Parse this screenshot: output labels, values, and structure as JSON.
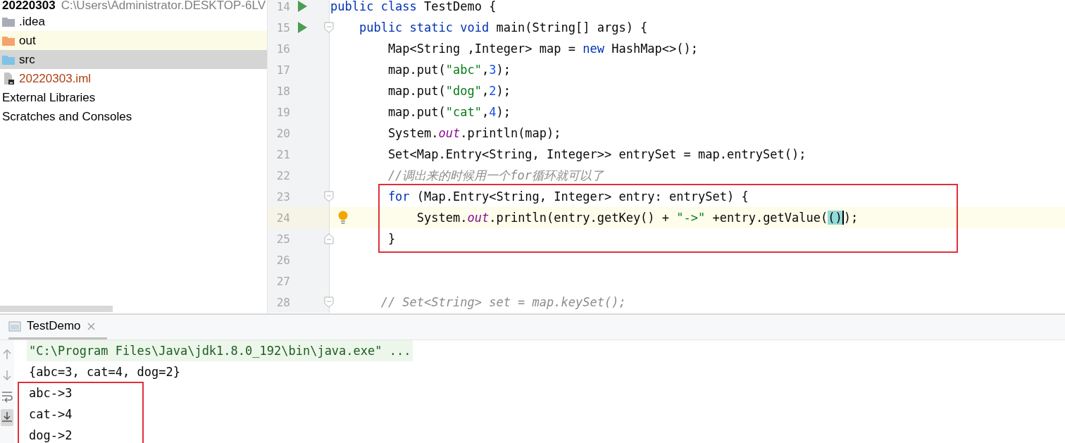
{
  "project": {
    "name": "20220303",
    "path": "C:\\Users\\Administrator.DESKTOP-6LV",
    "items": [
      {
        "label": ".idea",
        "kind": "folder",
        "color": "#a8adb5",
        "selected": false
      },
      {
        "label": "out",
        "kind": "folder",
        "color": "#f4a36c",
        "selected": false,
        "highlighted": true
      },
      {
        "label": "src",
        "kind": "folder",
        "color": "#7ec3e6",
        "selected": true
      },
      {
        "label": "20220303.iml",
        "kind": "module-file",
        "selected": false
      },
      {
        "label": "External Libraries",
        "kind": "plain",
        "selected": false
      },
      {
        "label": "Scratches and Consoles",
        "kind": "plain",
        "selected": false
      }
    ]
  },
  "editor": {
    "lines": [
      {
        "number": "14",
        "run": true,
        "tokens": [
          {
            "kind": "kw",
            "text": "public class "
          },
          {
            "kind": "plain",
            "text": "TestDemo {"
          }
        ]
      },
      {
        "number": "15",
        "run": true,
        "fold_start": true,
        "tokens": [
          {
            "kind": "kw",
            "text": "    public static void "
          },
          {
            "kind": "plain",
            "text": "main(String[] args) {"
          }
        ]
      },
      {
        "number": "16",
        "tokens": [
          {
            "kind": "plain",
            "text": "        Map<String ,Integer> map = "
          },
          {
            "kind": "kw",
            "text": "new "
          },
          {
            "kind": "plain",
            "text": "HashMap<>();"
          }
        ]
      },
      {
        "number": "17",
        "tokens": [
          {
            "kind": "plain",
            "text": "        map.put("
          },
          {
            "kind": "str",
            "text": "\"abc\""
          },
          {
            "kind": "plain",
            "text": ","
          },
          {
            "kind": "num",
            "text": "3"
          },
          {
            "kind": "plain",
            "text": ");"
          }
        ]
      },
      {
        "number": "18",
        "tokens": [
          {
            "kind": "plain",
            "text": "        map.put("
          },
          {
            "kind": "str",
            "text": "\"dog\""
          },
          {
            "kind": "plain",
            "text": ","
          },
          {
            "kind": "num",
            "text": "2"
          },
          {
            "kind": "plain",
            "text": ");"
          }
        ]
      },
      {
        "number": "19",
        "tokens": [
          {
            "kind": "plain",
            "text": "        map.put("
          },
          {
            "kind": "str",
            "text": "\"cat\""
          },
          {
            "kind": "plain",
            "text": ","
          },
          {
            "kind": "num",
            "text": "4"
          },
          {
            "kind": "plain",
            "text": ");"
          }
        ]
      },
      {
        "number": "20",
        "tokens": [
          {
            "kind": "plain",
            "text": "        System."
          },
          {
            "kind": "field",
            "text": "out"
          },
          {
            "kind": "plain",
            "text": ".println(map);"
          }
        ]
      },
      {
        "number": "21",
        "tokens": [
          {
            "kind": "plain",
            "text": "        Set<Map.Entry<String, Integer>> entrySet = map.entrySet();"
          }
        ]
      },
      {
        "number": "22",
        "tokens": [
          {
            "kind": "comment",
            "text": "        //调出来的时候用一个for循环就可以了"
          }
        ]
      },
      {
        "number": "23",
        "fold_start": true,
        "boxed": true,
        "tokens": [
          {
            "kind": "kw",
            "text": "        for "
          },
          {
            "kind": "plain",
            "text": "(Map.Entry<String, Integer> entry: entrySet) {"
          }
        ]
      },
      {
        "number": "24",
        "current": true,
        "bulb": true,
        "boxed": true,
        "tokens": [
          {
            "kind": "plain",
            "text": "            System."
          },
          {
            "kind": "field",
            "text": "out"
          },
          {
            "kind": "plain",
            "text": ".println(entry.getKey() + "
          },
          {
            "kind": "str",
            "text": "\"->\""
          },
          {
            "kind": "plain",
            "text": " +entry.getValue("
          },
          {
            "kind": "match",
            "text": "()",
            "caret": true
          },
          {
            "kind": "plain",
            "text": ");"
          }
        ]
      },
      {
        "number": "25",
        "fold_end": true,
        "boxed": true,
        "tokens": [
          {
            "kind": "plain",
            "text": "        }"
          }
        ]
      },
      {
        "number": "26"
      },
      {
        "number": "27"
      },
      {
        "number": "28",
        "fold_start": true,
        "tokens": [
          {
            "kind": "comment",
            "text": "       // Set<String> set = map.keySet();"
          }
        ]
      }
    ]
  },
  "console": {
    "tab": {
      "label": "TestDemo",
      "selected": true
    },
    "tools": [
      {
        "kind": "up",
        "selected": false
      },
      {
        "kind": "down",
        "selected": false
      },
      {
        "kind": "wrap",
        "selected": false
      },
      {
        "kind": "scroll-end",
        "selected": true
      }
    ],
    "lines": [
      {
        "kind": "command",
        "text": "\"C:\\Program Files\\Java\\jdk1.8.0_192\\bin\\java.exe\" ..."
      },
      {
        "kind": "output",
        "text": "{abc=3, cat=4, dog=2}"
      },
      {
        "kind": "output",
        "text": "abc->3",
        "boxed": true
      },
      {
        "kind": "output",
        "text": "cat->4",
        "boxed": true
      },
      {
        "kind": "output",
        "text": "dog->2",
        "boxed": true
      }
    ]
  }
}
